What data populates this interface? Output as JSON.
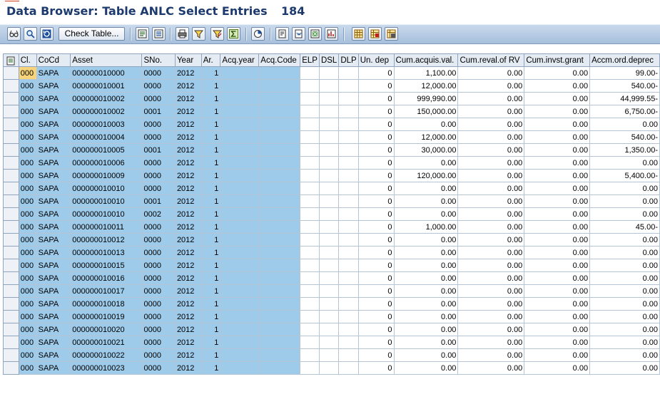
{
  "title": {
    "text": "Data Browser: Table ANLC Select Entries",
    "count": "184"
  },
  "toolbar": {
    "check_table_label": "Check Table...",
    "icons": [
      "glasses-icon",
      "detail-icon",
      "refresh-icon",
      "check-table-button",
      "details-list-icon",
      "print-preview-icon",
      "print-icon",
      "sort-icon",
      "filter-icon",
      "sum-icon",
      "abc-analysis-icon",
      "export-icon",
      "word-icon",
      "excel-icon",
      "graphic-icon",
      "layout-icon",
      "choose-layout-icon",
      "save-layout-icon"
    ]
  },
  "grid": {
    "columns": [
      "Cl.",
      "CoCd",
      "Asset",
      "SNo.",
      "Year",
      "Ar.",
      "Acq.year",
      "Acq.Code",
      "ELP",
      "DSL",
      "DLP",
      "Un. dep",
      "Cum.acquis.val.",
      "Cum.reval.of RV",
      "Cum.invst.grant",
      "Accm.ord.deprec"
    ],
    "rows": [
      [
        "000",
        "SAPA",
        "000000010000",
        "0000",
        "2012",
        "1",
        "",
        "",
        "",
        "",
        "",
        "0",
        "1,100.00",
        "0.00",
        "0.00",
        "99.00-"
      ],
      [
        "000",
        "SAPA",
        "000000010001",
        "0000",
        "2012",
        "1",
        "",
        "",
        "",
        "",
        "",
        "0",
        "12,000.00",
        "0.00",
        "0.00",
        "540.00-"
      ],
      [
        "000",
        "SAPA",
        "000000010002",
        "0000",
        "2012",
        "1",
        "",
        "",
        "",
        "",
        "",
        "0",
        "999,990.00",
        "0.00",
        "0.00",
        "44,999.55-"
      ],
      [
        "000",
        "SAPA",
        "000000010002",
        "0001",
        "2012",
        "1",
        "",
        "",
        "",
        "",
        "",
        "0",
        "150,000.00",
        "0.00",
        "0.00",
        "6,750.00-"
      ],
      [
        "000",
        "SAPA",
        "000000010003",
        "0000",
        "2012",
        "1",
        "",
        "",
        "",
        "",
        "",
        "0",
        "0.00",
        "0.00",
        "0.00",
        "0.00"
      ],
      [
        "000",
        "SAPA",
        "000000010004",
        "0000",
        "2012",
        "1",
        "",
        "",
        "",
        "",
        "",
        "0",
        "12,000.00",
        "0.00",
        "0.00",
        "540.00-"
      ],
      [
        "000",
        "SAPA",
        "000000010005",
        "0001",
        "2012",
        "1",
        "",
        "",
        "",
        "",
        "",
        "0",
        "30,000.00",
        "0.00",
        "0.00",
        "1,350.00-"
      ],
      [
        "000",
        "SAPA",
        "000000010006",
        "0000",
        "2012",
        "1",
        "",
        "",
        "",
        "",
        "",
        "0",
        "0.00",
        "0.00",
        "0.00",
        "0.00"
      ],
      [
        "000",
        "SAPA",
        "000000010009",
        "0000",
        "2012",
        "1",
        "",
        "",
        "",
        "",
        "",
        "0",
        "120,000.00",
        "0.00",
        "0.00",
        "5,400.00-"
      ],
      [
        "000",
        "SAPA",
        "000000010010",
        "0000",
        "2012",
        "1",
        "",
        "",
        "",
        "",
        "",
        "0",
        "0.00",
        "0.00",
        "0.00",
        "0.00"
      ],
      [
        "000",
        "SAPA",
        "000000010010",
        "0001",
        "2012",
        "1",
        "",
        "",
        "",
        "",
        "",
        "0",
        "0.00",
        "0.00",
        "0.00",
        "0.00"
      ],
      [
        "000",
        "SAPA",
        "000000010010",
        "0002",
        "2012",
        "1",
        "",
        "",
        "",
        "",
        "",
        "0",
        "0.00",
        "0.00",
        "0.00",
        "0.00"
      ],
      [
        "000",
        "SAPA",
        "000000010011",
        "0000",
        "2012",
        "1",
        "",
        "",
        "",
        "",
        "",
        "0",
        "1,000.00",
        "0.00",
        "0.00",
        "45.00-"
      ],
      [
        "000",
        "SAPA",
        "000000010012",
        "0000",
        "2012",
        "1",
        "",
        "",
        "",
        "",
        "",
        "0",
        "0.00",
        "0.00",
        "0.00",
        "0.00"
      ],
      [
        "000",
        "SAPA",
        "000000010013",
        "0000",
        "2012",
        "1",
        "",
        "",
        "",
        "",
        "",
        "0",
        "0.00",
        "0.00",
        "0.00",
        "0.00"
      ],
      [
        "000",
        "SAPA",
        "000000010015",
        "0000",
        "2012",
        "1",
        "",
        "",
        "",
        "",
        "",
        "0",
        "0.00",
        "0.00",
        "0.00",
        "0.00"
      ],
      [
        "000",
        "SAPA",
        "000000010016",
        "0000",
        "2012",
        "1",
        "",
        "",
        "",
        "",
        "",
        "0",
        "0.00",
        "0.00",
        "0.00",
        "0.00"
      ],
      [
        "000",
        "SAPA",
        "000000010017",
        "0000",
        "2012",
        "1",
        "",
        "",
        "",
        "",
        "",
        "0",
        "0.00",
        "0.00",
        "0.00",
        "0.00"
      ],
      [
        "000",
        "SAPA",
        "000000010018",
        "0000",
        "2012",
        "1",
        "",
        "",
        "",
        "",
        "",
        "0",
        "0.00",
        "0.00",
        "0.00",
        "0.00"
      ],
      [
        "000",
        "SAPA",
        "000000010019",
        "0000",
        "2012",
        "1",
        "",
        "",
        "",
        "",
        "",
        "0",
        "0.00",
        "0.00",
        "0.00",
        "0.00"
      ],
      [
        "000",
        "SAPA",
        "000000010020",
        "0000",
        "2012",
        "1",
        "",
        "",
        "",
        "",
        "",
        "0",
        "0.00",
        "0.00",
        "0.00",
        "0.00"
      ],
      [
        "000",
        "SAPA",
        "000000010021",
        "0000",
        "2012",
        "1",
        "",
        "",
        "",
        "",
        "",
        "0",
        "0.00",
        "0.00",
        "0.00",
        "0.00"
      ],
      [
        "000",
        "SAPA",
        "000000010022",
        "0000",
        "2012",
        "1",
        "",
        "",
        "",
        "",
        "",
        "0",
        "0.00",
        "0.00",
        "0.00",
        "0.00"
      ],
      [
        "000",
        "SAPA",
        "000000010023",
        "0000",
        "2012",
        "1",
        "",
        "",
        "",
        "",
        "",
        "0",
        "0.00",
        "0.00",
        "0.00",
        "0.00"
      ]
    ]
  },
  "colors": {
    "key_column": "#9ecbea",
    "selected_cell": "#f7d47a",
    "title": "#1c3a6e",
    "toolbar": "#b5cbe3"
  }
}
